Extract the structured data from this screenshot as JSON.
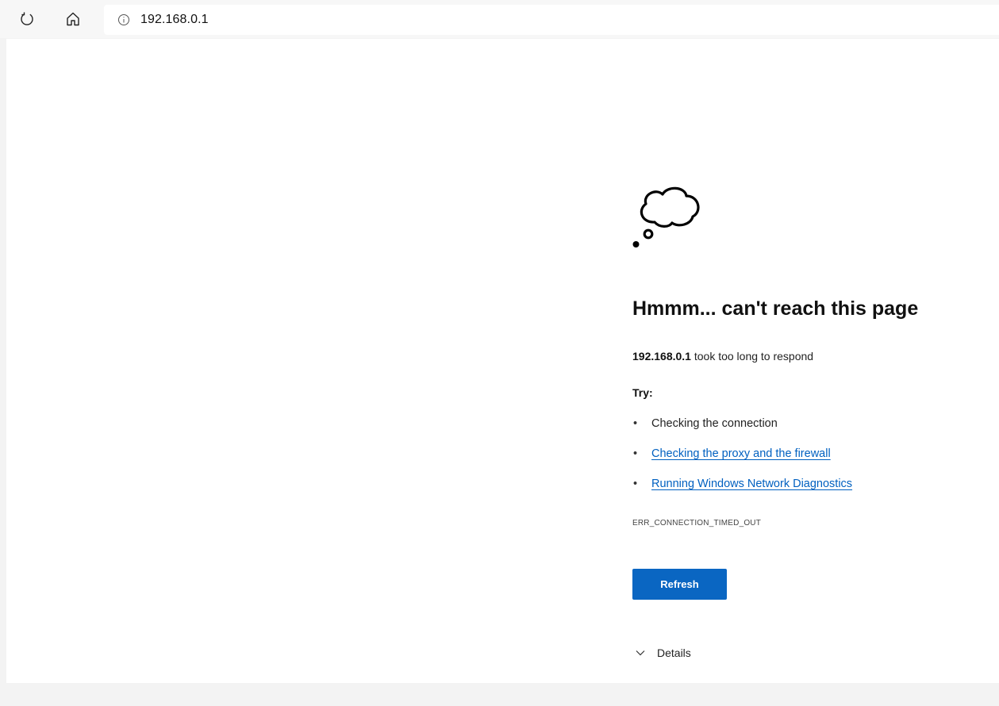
{
  "browser": {
    "url": "192.168.0.1",
    "icons": [
      "refresh-icon",
      "home-icon",
      "info-icon"
    ]
  },
  "error": {
    "heading": "Hmmm... can't reach this page",
    "host": "192.168.0.1",
    "message": " took too long to respond",
    "try_label": "Try:",
    "suggestions": [
      {
        "label": "Checking the connection",
        "link": false
      },
      {
        "label": "Checking the proxy and the firewall",
        "link": true
      },
      {
        "label": "Running Windows Network Diagnostics",
        "link": true
      }
    ],
    "code": "ERR_CONNECTION_TIMED_OUT",
    "refresh_label": "Refresh",
    "details_label": "Details"
  },
  "colors": {
    "accent": "#0a66c2",
    "link": "#0060c0"
  }
}
